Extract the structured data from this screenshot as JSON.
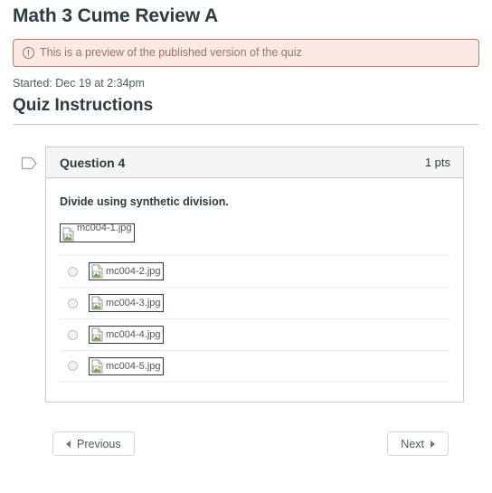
{
  "quiz": {
    "title": "Math 3 Cume Review A",
    "preview_alert": {
      "icon": "exclamation-circle-icon",
      "text": "This is a preview of the published version of the quiz"
    },
    "started_label": "Started: Dec 19 at 2:34pm",
    "instructions_heading": "Quiz Instructions"
  },
  "question": {
    "flag_icon": "flag-outline-icon",
    "name": "Question 4",
    "points": "1 pts",
    "text": "Divide using synthetic division.",
    "prompt_image": {
      "icon": "broken-image-icon",
      "alt": "mc004-1.jpg"
    },
    "answers": [
      {
        "icon": "broken-image-icon",
        "alt": "mc004-2.jpg",
        "selected": false
      },
      {
        "icon": "broken-image-icon",
        "alt": "mc004-3.jpg",
        "selected": false
      },
      {
        "icon": "broken-image-icon",
        "alt": "mc004-4.jpg",
        "selected": false
      },
      {
        "icon": "broken-image-icon",
        "alt": "mc004-5.jpg",
        "selected": false
      }
    ]
  },
  "navigation": {
    "previous_label": "Previous",
    "next_label": "Next",
    "previous_icon": "triangle-left-icon",
    "next_icon": "triangle-right-icon"
  },
  "colors": {
    "heading": "#2d3b45",
    "alert_bg": "#fbe9e3",
    "alert_border": "#c37d6a",
    "alert_text": "#a5705c",
    "box_border": "#c7cdd1",
    "header_bg": "#f5f5f5"
  }
}
